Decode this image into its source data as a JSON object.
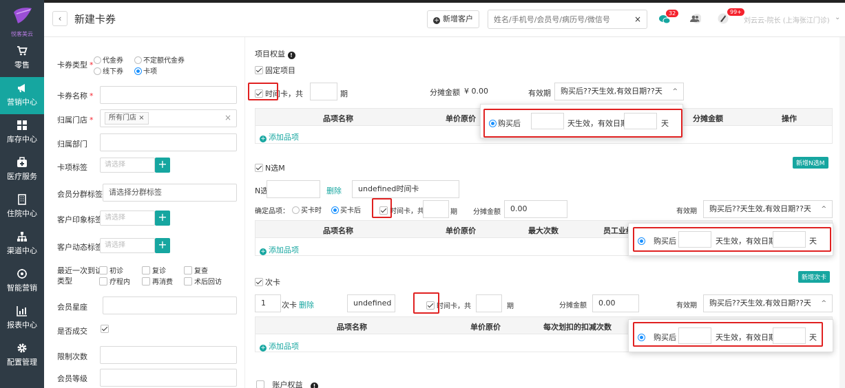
{
  "app": {
    "logo_text": "悦客美云",
    "page_title": "新建卡券",
    "new_customer_label": "新增客户",
    "search_placeholder": "姓名/手机号/会员号/病历号/微信号",
    "search_clear": "×",
    "msg_badge": "32",
    "notice_badge": "99+",
    "user_name": "刘云云-院长 (上海张江门诊)"
  },
  "sidebar": {
    "items": [
      {
        "label": "零售",
        "icon": "cart-icon"
      },
      {
        "label": "营销中心",
        "icon": "megaphone-icon"
      },
      {
        "label": "库存中心",
        "icon": "grid-icon"
      },
      {
        "label": "医疗服务",
        "icon": "medkit-icon"
      },
      {
        "label": "住院中心",
        "icon": "building-icon"
      },
      {
        "label": "渠道中心",
        "icon": "sitemap-icon"
      },
      {
        "label": "智能营销",
        "icon": "smart-icon"
      },
      {
        "label": "报表中心",
        "icon": "bar-chart-icon"
      },
      {
        "label": "配置管理",
        "icon": "gear-icon"
      }
    ],
    "active_index": 1
  },
  "form": {
    "card_type_label": "卡券类型",
    "card_type_options": [
      "代金券",
      "不定额代金券",
      "线下券",
      "卡项"
    ],
    "card_name_label": "卡券名称",
    "store_label": "归属门店",
    "store_tag": "所有门店",
    "store_tag_close": "×",
    "store_clear": "×",
    "dept_label": "归属部门",
    "card_tag_label": "卡项标签",
    "card_tag_placeholder": "请选择",
    "member_group_label": "会员分群标签",
    "member_group_placeholder": "请选择分群标签",
    "impression_label": "客户印象标签",
    "impression_placeholder": "请选择",
    "dynamic_label": "客户动态标签",
    "dynamic_placeholder": "请选择",
    "visit_type_label_1": "最近一次到访",
    "visit_type_label_2": "类型",
    "visit_options": [
      "初诊",
      "复诊",
      "复查",
      "疗程内",
      "再消费",
      "术后回访"
    ],
    "star_label": "会员星座",
    "deal_label": "是否成交",
    "limit_label": "限制次数",
    "level_label": "会员等级",
    "required_mark": "*"
  },
  "rights": {
    "title": "项目权益",
    "fixed": {
      "label": "固定项目",
      "time_card_label": "时间卡，共",
      "period_unit": "期",
      "alloc_label": "分摊金额",
      "alloc_value": "¥ 0.00",
      "valid_label": "有效期",
      "valid_value": "购买后??天生效,有效日期??天",
      "caret": "^",
      "columns": [
        "品项名称",
        "单价原价",
        "分摊金额",
        "操作"
      ],
      "add_item": "添加品项",
      "popup": {
        "after_buy": "购买后",
        "effective": "天生效，有效日期",
        "day": "天"
      }
    },
    "nm": {
      "label": "N选M",
      "new_btn": "新增N选M",
      "n_label": "N选",
      "delete": "删除",
      "name_value": "undefined时间卡",
      "confirm_label": "确定品项：",
      "opt_buy_time": "买卡时",
      "opt_after_buy": "买卡后",
      "time_card_label": "时间卡，共",
      "period_unit": "期",
      "alloc_label": "分摊金额",
      "alloc_value": "0.00",
      "valid_label": "有效期",
      "valid_value": "购买后??天生效,有效日期??天",
      "caret": "^",
      "columns": [
        "品项名称",
        "单价原价",
        "最大次数",
        "员工业绩"
      ],
      "add_item": "添加品项",
      "popup": {
        "after_buy": "购买后",
        "effective": "天生效，有效日期",
        "day": "天"
      }
    },
    "count": {
      "label": "次卡",
      "new_btn": "新增次卡",
      "count_value": "1",
      "count_unit": "次卡",
      "delete": "删除",
      "name_value": "undefined",
      "time_card_label": "时间卡，共",
      "period_unit": "期",
      "alloc_label": "分摊金额",
      "alloc_value": "0.00",
      "valid_label": "有效期",
      "valid_value": "购买后??天生效,有效日期??天",
      "caret": "^",
      "columns": [
        "品项名称",
        "单价原价",
        "每次划扣的扣减次数"
      ],
      "add_item": "添加品项",
      "popup": {
        "after_buy": "购买后",
        "effective": "天生效，有效日期",
        "day": "天"
      }
    },
    "account_label": "账户权益"
  }
}
